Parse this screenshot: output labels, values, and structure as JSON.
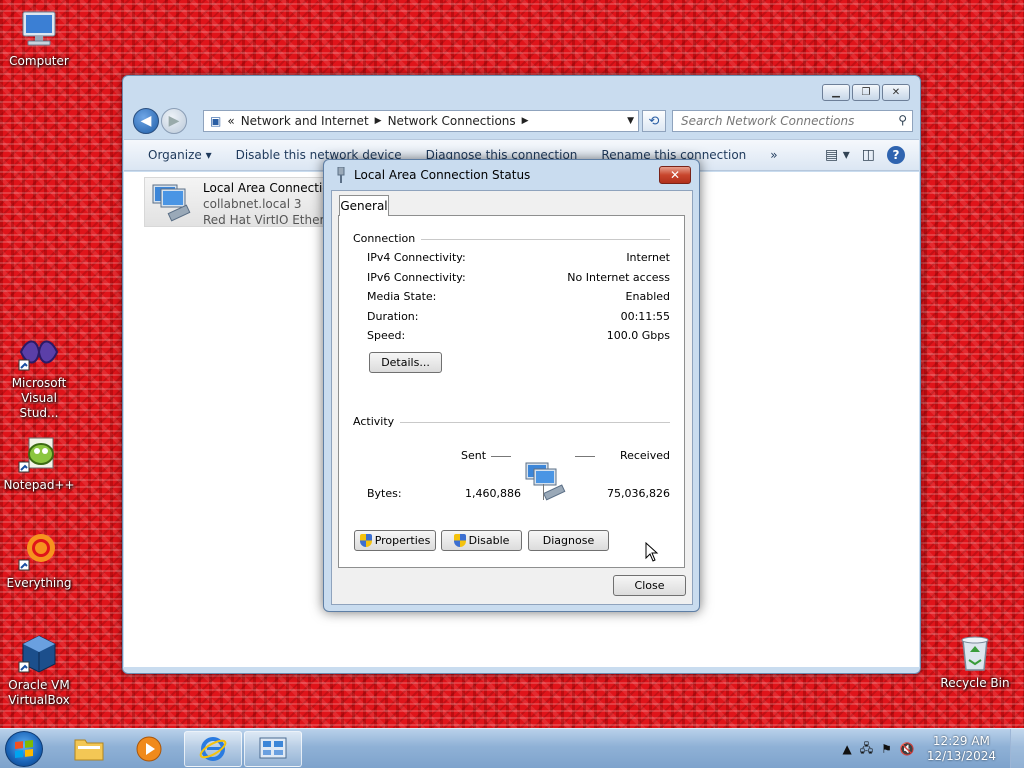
{
  "desktop": {
    "icons": [
      {
        "label": "Computer"
      },
      {
        "label": "Microsoft Visual Stud..."
      },
      {
        "label": "Notepad++"
      },
      {
        "label": "Everything"
      },
      {
        "label": "Oracle VM VirtualBox"
      },
      {
        "label": "Recycle Bin"
      }
    ]
  },
  "explorer": {
    "breadcrumb_prefix": "«",
    "breadcrumb": [
      "Network and Internet",
      "Network Connections"
    ],
    "search_placeholder": "Search Network Connections",
    "toolbar": {
      "organize": "Organize ▾",
      "disable": "Disable this network device",
      "diagnose": "Diagnose this connection",
      "rename": "Rename this connection",
      "more": "»"
    },
    "connection": {
      "name": "Local Area Connection",
      "network": "collabnet.local  3",
      "adapter": "Red Hat VirtIO Ethernet Adapter"
    }
  },
  "dialog": {
    "title": "Local Area Connection Status",
    "tab": "General",
    "connection_group": "Connection",
    "rows": [
      {
        "label": "IPv4 Connectivity:",
        "value": "Internet"
      },
      {
        "label": "IPv6 Connectivity:",
        "value": "No Internet access"
      },
      {
        "label": "Media State:",
        "value": "Enabled"
      },
      {
        "label": "Duration:",
        "value": "00:11:55"
      },
      {
        "label": "Speed:",
        "value": "100.0 Gbps"
      }
    ],
    "details_button": "Details...",
    "activity_group": "Activity",
    "sent_label": "Sent",
    "received_label": "Received",
    "bytes_label": "Bytes:",
    "bytes_sent": "1,460,886",
    "bytes_received": "75,036,826",
    "properties_button": "Properties",
    "disable_button": "Disable",
    "diagnose_button": "Diagnose",
    "close_button": "Close"
  },
  "taskbar": {
    "time": "12:29 AM",
    "date": "12/13/2024"
  }
}
